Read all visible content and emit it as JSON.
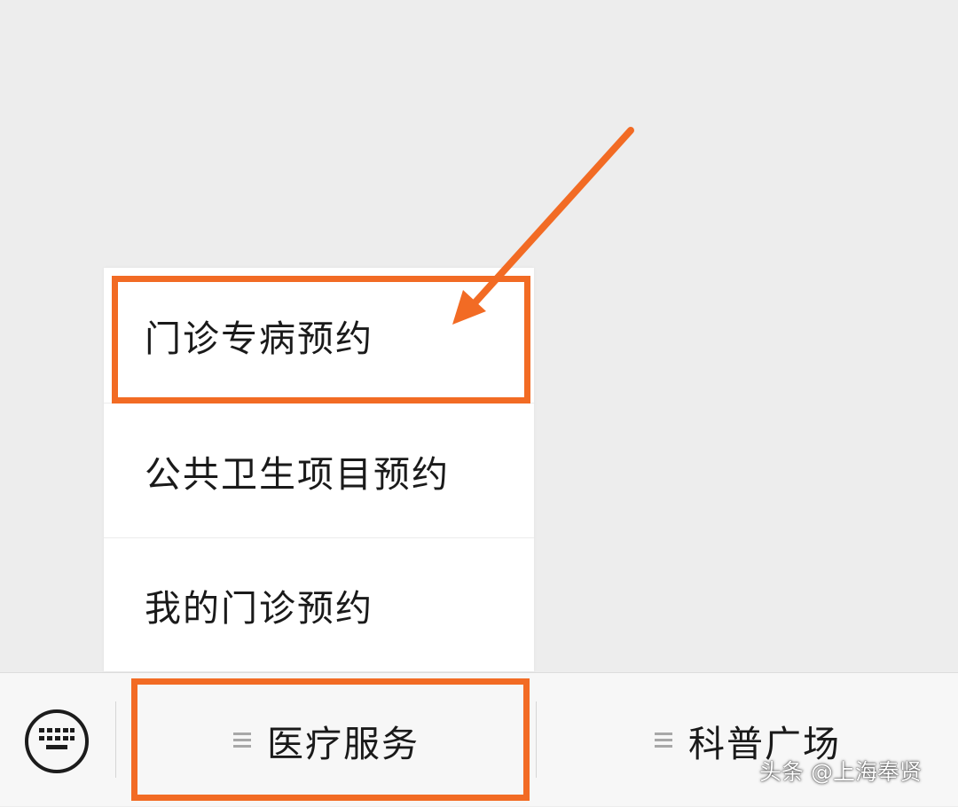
{
  "popup_menu": {
    "items": [
      {
        "label": "门诊专病预约"
      },
      {
        "label": "公共卫生项目预约"
      },
      {
        "label": "我的门诊预约"
      }
    ]
  },
  "bottom_menu": {
    "keyboard_icon": "keyboard-icon",
    "buttons": [
      {
        "label": "医疗服务",
        "icon": "menu-lines-icon"
      },
      {
        "label": "科普广场",
        "icon": "menu-lines-icon"
      }
    ]
  },
  "annotation": {
    "highlight_color": "#f26b24"
  },
  "watermark": {
    "text": "头条 @上海奉贤"
  }
}
